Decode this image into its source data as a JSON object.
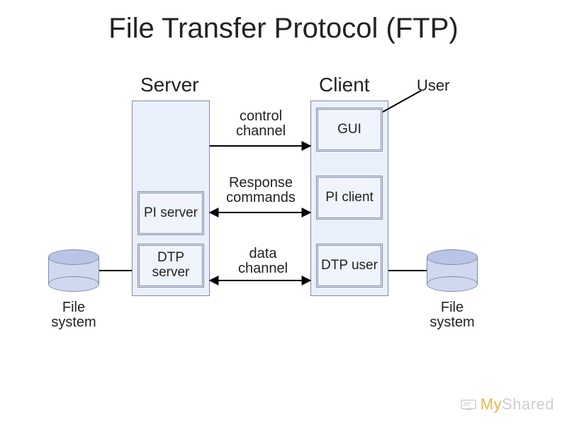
{
  "title": "File Transfer Protocol (FTP)",
  "headers": {
    "server": "Server",
    "client": "Client",
    "user": "User"
  },
  "server_boxes": {
    "pi": "PI\nserver",
    "dtp": "DTP\nserver"
  },
  "client_boxes": {
    "gui": "GUI",
    "pi": "PI\nclient",
    "dtp": "DTP\nuser"
  },
  "channels": {
    "control": "control\nchannel",
    "response": "Response\ncommands",
    "data": "data\nchannel"
  },
  "fs_left": "File\nsystem",
  "fs_right": "File\nsystem",
  "watermark_brand_a": "My",
  "watermark_brand_b": "Shared"
}
